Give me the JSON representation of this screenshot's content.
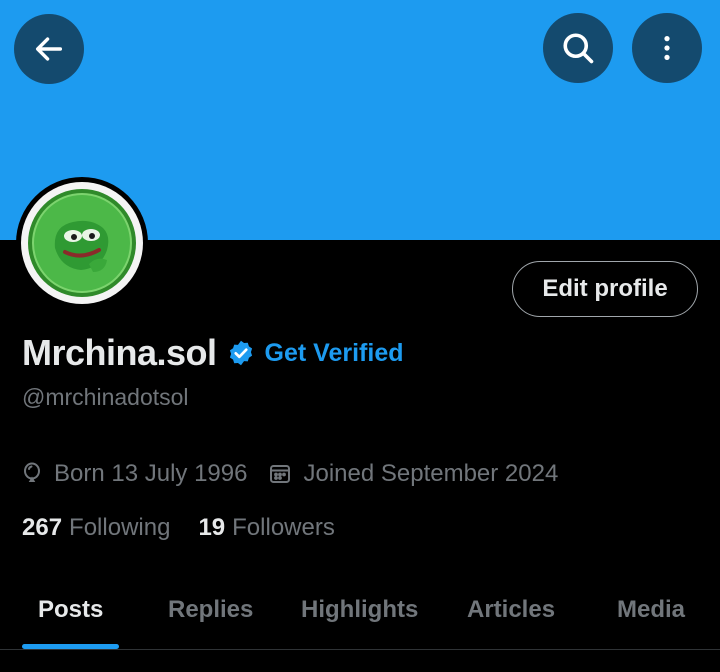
{
  "header": {
    "back_icon": "arrow-left-icon",
    "search_icon": "search-icon",
    "more_icon": "more-vertical-icon",
    "banner_color": "#1d9bf0"
  },
  "profile": {
    "display_name": "Mrchina.sol",
    "verified_icon": "verified-badge-icon",
    "get_verified_label": "Get Verified",
    "handle": "@mrchinadotsol",
    "edit_profile_label": "Edit profile",
    "born": "Born 13 July 1996",
    "joined": "Joined September 2024",
    "following_count": "267",
    "following_label": "Following",
    "followers_count": "19",
    "followers_label": "Followers",
    "accent_color": "#1d9bf0"
  },
  "tabs": [
    {
      "label": "Posts",
      "active": true
    },
    {
      "label": "Replies",
      "active": false
    },
    {
      "label": "Highlights",
      "active": false
    },
    {
      "label": "Articles",
      "active": false
    },
    {
      "label": "Media",
      "active": false
    }
  ]
}
